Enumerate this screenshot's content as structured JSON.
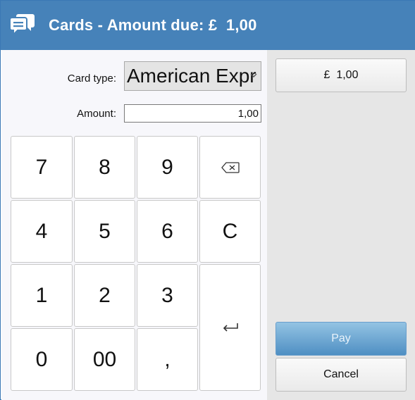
{
  "window": {
    "title": "Cards - Amount due: £  1,00",
    "icon": "chat-bubbles-icon",
    "accent_color": "#4682b9"
  },
  "form": {
    "card_type_label": "Card type:",
    "card_type_value": "American Expr",
    "amount_label": "Amount:",
    "amount_value": "1,00"
  },
  "keypad": {
    "k7": "7",
    "k8": "8",
    "k9": "9",
    "backspace_icon": "backspace-icon",
    "k4": "4",
    "k5": "5",
    "k6": "6",
    "clear": "C",
    "k1": "1",
    "k2": "2",
    "k3": "3",
    "enter_icon": "enter-icon",
    "k0": "0",
    "k00": "00",
    "comma": ","
  },
  "side": {
    "amount_button": "£  1,00",
    "pay_button": "Pay",
    "cancel_button": "Cancel"
  }
}
